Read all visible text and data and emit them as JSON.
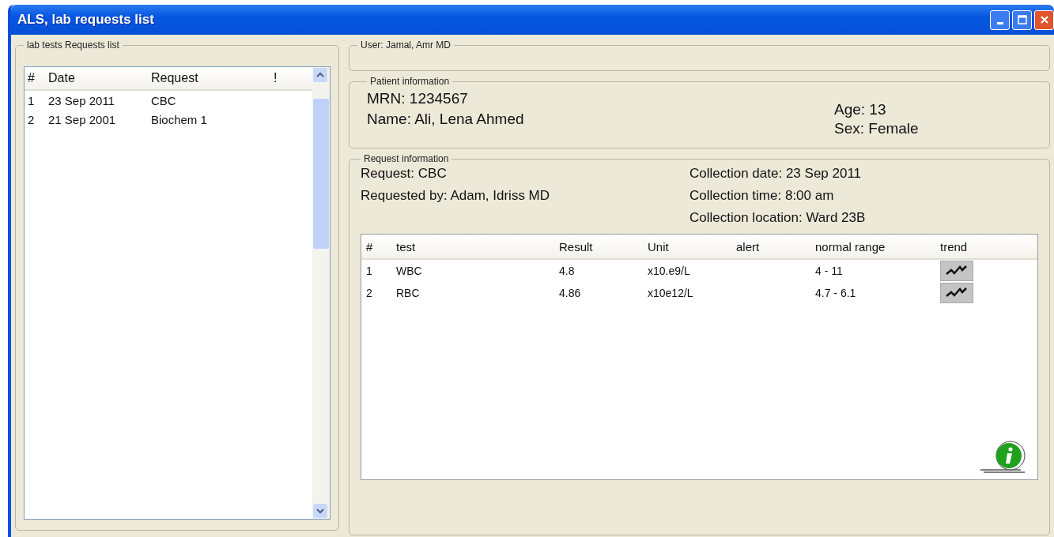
{
  "window": {
    "title": "ALS, lab requests list"
  },
  "requests_panel": {
    "legend": "lab tests Requests list",
    "columns": [
      "#",
      "Date",
      "Request",
      "!"
    ],
    "rows": [
      {
        "num": "1",
        "date": "23 Sep 2011",
        "request": "CBC"
      },
      {
        "num": "2",
        "date": "21 Sep 2001",
        "request": "Biochem 1"
      }
    ]
  },
  "user_panel": {
    "legend": "User: Jamal, Amr MD"
  },
  "patient_panel": {
    "legend": "Patient information",
    "left": [
      "MRN: 1234567",
      "Name: Ali, Lena Ahmed"
    ],
    "right": [
      "Age: 13",
      "Sex: Female"
    ]
  },
  "request_panel": {
    "legend": "Request information",
    "left": [
      "Request: CBC",
      "Requested by: Adam, Idriss MD"
    ],
    "right": [
      "Collection date: 23 Sep 2011",
      "Collection time: 8:00 am",
      "Collection location: Ward 23B"
    ],
    "results": {
      "columns": [
        "#",
        "test",
        "Result",
        "Unit",
        "alert",
        "normal range",
        "trend"
      ],
      "rows": [
        {
          "num": "1",
          "test": "WBC",
          "result": "4.8",
          "unit": "x10.e9/L",
          "range": "4 - 11"
        },
        {
          "num": "2",
          "test": "RBC",
          "result": "4.86",
          "unit": "x10e12/L",
          "range": "4.7 - 6.1"
        }
      ]
    }
  }
}
